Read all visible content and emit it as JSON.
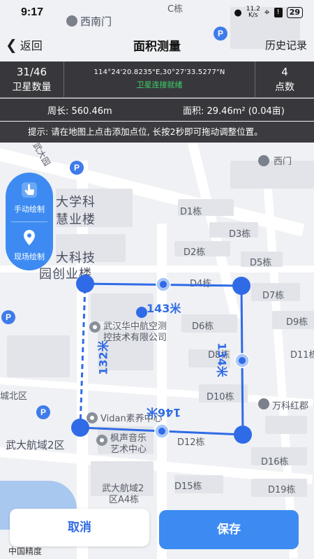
{
  "status_bar": {
    "time": "9:17",
    "net_speed": "11.2",
    "net_unit": "K/s",
    "battery": "29"
  },
  "header": {
    "back_label": "返回",
    "title": "面积测量",
    "history_label": "历史记录"
  },
  "info": {
    "satellites_value": "31/46",
    "satellites_label": "卫星数量",
    "coordinates": "114°24'20.8235\"E,30°27'33.5277\"N",
    "gps_status": "卫星连接就绪",
    "points_value": "4",
    "points_label": "点数"
  },
  "measure": {
    "perimeter": "周长: 560.46m",
    "area": "面积: 29.46m² (0.04亩)"
  },
  "tip": "提示: 请在地图上点击添加点位, 长按2秒即可拖动调整位置。",
  "draw_modes": {
    "manual_label": "手动绘制",
    "field_label": "现场绘制"
  },
  "polygon": {
    "segment_labels": [
      "143米",
      "134米",
      "146米",
      "132米"
    ]
  },
  "map_labels": {
    "south_gate": "西南门",
    "c_building": "C栋",
    "west_gate": "西门",
    "university": "大学科",
    "huiye": "慧业楼",
    "tech": "大科技",
    "innovation": "园创业楼",
    "company_line1": "武汉华中航空测",
    "company_line2": "控技术有限公司",
    "vidan": "Vidan素养中心",
    "music_line1": "枫声音乐",
    "music_line2": "艺术中心",
    "wanke": "万科红郡",
    "hangyu": "武大航域2区",
    "north": "城北区",
    "hangyu_a4_line1": "武大航域2",
    "hangyu_a4_line2": "区A4栋",
    "road_name": "武大园",
    "d1": "D1栋",
    "d2": "D2栋",
    "d3": "D3栋",
    "d4": "D4栋",
    "d5": "D5栋",
    "d6": "D6栋",
    "d7": "D7栋",
    "d8": "D8栋",
    "d9": "D9栋",
    "d10": "D10栋",
    "d11": "D11栋",
    "d12": "D12栋",
    "d15": "D15栋",
    "d16": "D16栋",
    "d19": "D19栋"
  },
  "buttons": {
    "cancel": "取消",
    "save": "保存"
  },
  "brand": "中国精度",
  "colors": {
    "accent": "#3d8bf2",
    "polygon": "#2f6be6",
    "gps_ok": "#3ed06a"
  }
}
